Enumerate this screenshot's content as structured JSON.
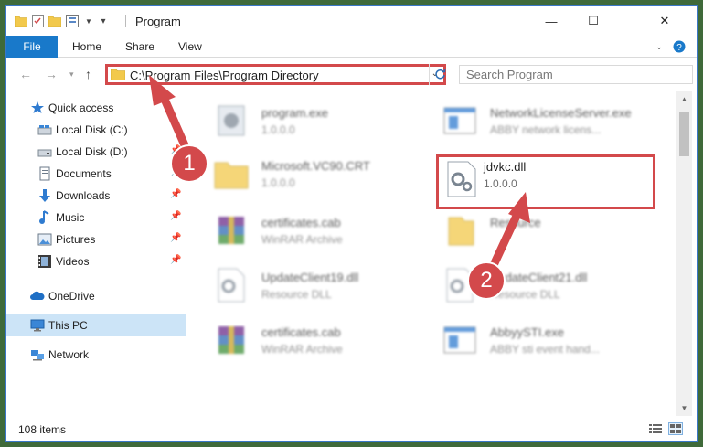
{
  "window": {
    "title": "Program",
    "controls": {
      "minimize": "—",
      "maximize": "☐",
      "close": "✕"
    }
  },
  "ribbon": {
    "tabs": [
      "File",
      "Home",
      "Share",
      "View"
    ],
    "help": "?"
  },
  "address": {
    "path": "C:\\Program Files\\Program Directory",
    "search_placeholder": "Search Program"
  },
  "sidebar": {
    "items": [
      {
        "label": "Quick access",
        "icon": "star-icon",
        "pinned": false
      },
      {
        "label": "Local Disk (C:)",
        "icon": "drive-icon",
        "pinned": false
      },
      {
        "label": "Local Disk (D:)",
        "icon": "drive-icon",
        "pinned": true
      },
      {
        "label": "Documents",
        "icon": "documents-icon",
        "pinned": true
      },
      {
        "label": "Downloads",
        "icon": "download-icon",
        "pinned": true
      },
      {
        "label": "Music",
        "icon": "music-icon",
        "pinned": true
      },
      {
        "label": "Pictures",
        "icon": "pictures-icon",
        "pinned": true
      },
      {
        "label": "Videos",
        "icon": "videos-icon",
        "pinned": true
      },
      {
        "label": "OneDrive",
        "icon": "cloud-icon",
        "pinned": false
      },
      {
        "label": "This PC",
        "icon": "computer-icon",
        "pinned": false,
        "selected": true
      },
      {
        "label": "Network",
        "icon": "network-icon",
        "pinned": false
      }
    ]
  },
  "files": [
    {
      "name": "program.exe",
      "sub": "1.0.0.0",
      "icon": "exe-icon"
    },
    {
      "name": "NetworkLicenseServer.exe",
      "sub": "ABBY network licens...",
      "icon": "exe-window-icon"
    },
    {
      "name": "Microsoft.VC90.CRT",
      "sub": "1.0.0.0",
      "icon": "folder-icon"
    },
    {
      "name": "jdvkc.dll",
      "sub": "1.0.0.0",
      "icon": "dll-gear-icon",
      "highlighted": true
    },
    {
      "name": "certificates.cab",
      "sub": "WinRAR Archive",
      "icon": "rar-icon"
    },
    {
      "name": "Resource",
      "sub": "",
      "icon": "folder-icon"
    },
    {
      "name": "UpdateClient19.dll",
      "sub": "Resource DLL",
      "icon": "dll-gear-icon"
    },
    {
      "name": "UpdateClient21.dll",
      "sub": "Resource DLL",
      "icon": "dll-gear-icon"
    },
    {
      "name": "certificates.cab",
      "sub": "WinRAR Archive",
      "icon": "rar-icon"
    },
    {
      "name": "AbbyySTI.exe",
      "sub": "ABBY sti event hand...",
      "icon": "exe-window-icon"
    }
  ],
  "status": {
    "count": "108 items"
  },
  "annotations": {
    "step1": "1",
    "step2": "2"
  },
  "colors": {
    "accent": "#1979ca",
    "highlight": "#d3494b",
    "selected": "#cce4f7"
  }
}
